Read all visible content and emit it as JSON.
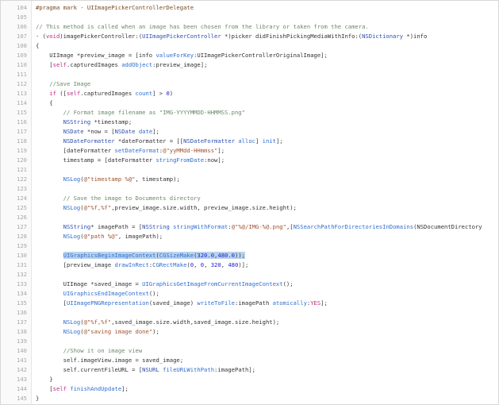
{
  "editor": {
    "lines": [
      {
        "n": "104",
        "tokens": [
          {
            "t": "#pragma mark - UIImagePickerControllerDelegate",
            "c": "pragma"
          }
        ]
      },
      {
        "n": "105",
        "tokens": []
      },
      {
        "n": "106",
        "tokens": [
          {
            "t": "// This method is called when an image has been chosen from the library or taken from the camera.",
            "c": "comment"
          }
        ]
      },
      {
        "n": "107",
        "tokens": [
          {
            "t": "- (",
            "c": "plain"
          },
          {
            "t": "void",
            "c": "kw"
          },
          {
            "t": ")imagePickerController:(",
            "c": "plain"
          },
          {
            "t": "UIImagePickerController",
            "c": "type"
          },
          {
            "t": " *)picker didFinishPickingMediaWithInfo:(",
            "c": "plain"
          },
          {
            "t": "NSDictionary",
            "c": "type"
          },
          {
            "t": " *)info",
            "c": "plain"
          }
        ]
      },
      {
        "n": "108",
        "tokens": [
          {
            "t": "{",
            "c": "plain"
          }
        ]
      },
      {
        "n": "109",
        "tokens": [
          {
            "t": "    UIImage *preview_image = [info ",
            "c": "plain"
          },
          {
            "t": "valueForKey",
            "c": "method"
          },
          {
            "t": ":UIImagePickerControllerOriginalImage];",
            "c": "plain"
          }
        ]
      },
      {
        "n": "110",
        "tokens": [
          {
            "t": "    [",
            "c": "plain"
          },
          {
            "t": "self",
            "c": "kw"
          },
          {
            "t": ".capturedImages ",
            "c": "plain"
          },
          {
            "t": "addObject",
            "c": "method"
          },
          {
            "t": ":preview_image];",
            "c": "plain"
          }
        ]
      },
      {
        "n": "111",
        "tokens": []
      },
      {
        "n": "112",
        "tokens": [
          {
            "t": "    //Save Image",
            "c": "comment"
          }
        ]
      },
      {
        "n": "113",
        "tokens": [
          {
            "t": "    ",
            "c": "plain"
          },
          {
            "t": "if",
            "c": "kw"
          },
          {
            "t": " ([",
            "c": "plain"
          },
          {
            "t": "self",
            "c": "kw"
          },
          {
            "t": ".capturedImages ",
            "c": "plain"
          },
          {
            "t": "count",
            "c": "method"
          },
          {
            "t": "] > ",
            "c": "plain"
          },
          {
            "t": "0",
            "c": "num"
          },
          {
            "t": ")",
            "c": "plain"
          }
        ]
      },
      {
        "n": "114",
        "tokens": [
          {
            "t": "    {",
            "c": "plain"
          }
        ]
      },
      {
        "n": "115",
        "tokens": [
          {
            "t": "        // Format image filename as \"IMG-YYYYMMDD-HHMMSS.png\"",
            "c": "comment"
          }
        ]
      },
      {
        "n": "116",
        "tokens": [
          {
            "t": "        ",
            "c": "plain"
          },
          {
            "t": "NSString",
            "c": "type"
          },
          {
            "t": " *timestamp;",
            "c": "plain"
          }
        ]
      },
      {
        "n": "117",
        "tokens": [
          {
            "t": "        ",
            "c": "plain"
          },
          {
            "t": "NSDate",
            "c": "type"
          },
          {
            "t": " *now = [",
            "c": "plain"
          },
          {
            "t": "NSDate",
            "c": "type"
          },
          {
            "t": " ",
            "c": "plain"
          },
          {
            "t": "date",
            "c": "method"
          },
          {
            "t": "];",
            "c": "plain"
          }
        ]
      },
      {
        "n": "118",
        "tokens": [
          {
            "t": "        ",
            "c": "plain"
          },
          {
            "t": "NSDateFormatter",
            "c": "type"
          },
          {
            "t": " *dateFormatter = [[",
            "c": "plain"
          },
          {
            "t": "NSDateFormatter",
            "c": "type"
          },
          {
            "t": " ",
            "c": "plain"
          },
          {
            "t": "alloc",
            "c": "method"
          },
          {
            "t": "] ",
            "c": "plain"
          },
          {
            "t": "init",
            "c": "method"
          },
          {
            "t": "];",
            "c": "plain"
          }
        ]
      },
      {
        "n": "119",
        "tokens": [
          {
            "t": "        [dateFormatter ",
            "c": "plain"
          },
          {
            "t": "setDateFormat",
            "c": "method"
          },
          {
            "t": ":",
            "c": "plain"
          },
          {
            "t": "@\"yyMMdd-HHmmss\"",
            "c": "str"
          },
          {
            "t": "];",
            "c": "plain"
          }
        ]
      },
      {
        "n": "120",
        "tokens": [
          {
            "t": "        timestamp = [dateFormatter ",
            "c": "plain"
          },
          {
            "t": "stringFromDate",
            "c": "method"
          },
          {
            "t": ":now];",
            "c": "plain"
          }
        ]
      },
      {
        "n": "121",
        "tokens": []
      },
      {
        "n": "122",
        "tokens": [
          {
            "t": "        ",
            "c": "plain"
          },
          {
            "t": "NSLog",
            "c": "method"
          },
          {
            "t": "(",
            "c": "plain"
          },
          {
            "t": "@\"timestamp %@\"",
            "c": "str"
          },
          {
            "t": ", timestamp);",
            "c": "plain"
          }
        ]
      },
      {
        "n": "123",
        "tokens": []
      },
      {
        "n": "124",
        "tokens": [
          {
            "t": "        // Save the image to Documents directory",
            "c": "comment"
          }
        ]
      },
      {
        "n": "125",
        "tokens": [
          {
            "t": "        ",
            "c": "plain"
          },
          {
            "t": "NSLog",
            "c": "method"
          },
          {
            "t": "(",
            "c": "plain"
          },
          {
            "t": "@\"%f,%f\"",
            "c": "str"
          },
          {
            "t": ",preview_image.size.width, preview_image.size.height);",
            "c": "plain"
          }
        ]
      },
      {
        "n": "126",
        "tokens": []
      },
      {
        "n": "127",
        "tokens": [
          {
            "t": "        ",
            "c": "plain"
          },
          {
            "t": "NSString",
            "c": "type"
          },
          {
            "t": "* imagePath = [",
            "c": "plain"
          },
          {
            "t": "NSString",
            "c": "type"
          },
          {
            "t": " ",
            "c": "plain"
          },
          {
            "t": "stringWithFormat",
            "c": "method"
          },
          {
            "t": ":",
            "c": "plain"
          },
          {
            "t": "@\"%@/IMG-%@.png\"",
            "c": "str"
          },
          {
            "t": ",[",
            "c": "plain"
          },
          {
            "t": "NSSearchPathForDirectoriesInDomains",
            "c": "method"
          },
          {
            "t": "(NSDocumentDirectory",
            "c": "plain"
          }
        ]
      },
      {
        "n": "128",
        "tokens": [
          {
            "t": "        ",
            "c": "plain"
          },
          {
            "t": "NSLog",
            "c": "method"
          },
          {
            "t": "(",
            "c": "plain"
          },
          {
            "t": "@\"path %@\"",
            "c": "str"
          },
          {
            "t": ", imagePath);",
            "c": "plain"
          }
        ]
      },
      {
        "n": "129",
        "tokens": []
      },
      {
        "n": "130",
        "hl": true,
        "tokens": [
          {
            "t": "        ",
            "c": "plain"
          },
          {
            "t": "UIGraphicsBeginImageContext",
            "c": "method"
          },
          {
            "t": "(",
            "c": "plain"
          },
          {
            "t": "CGSizeMake",
            "c": "method"
          },
          {
            "t": "(",
            "c": "plain"
          },
          {
            "t": "320.0",
            "c": "num"
          },
          {
            "t": ",",
            "c": "plain"
          },
          {
            "t": "480.0",
            "c": "num"
          },
          {
            "t": "));",
            "c": "plain"
          }
        ]
      },
      {
        "n": "131",
        "tokens": [
          {
            "t": "        [preview_image ",
            "c": "plain"
          },
          {
            "t": "drawInRect",
            "c": "method"
          },
          {
            "t": ":",
            "c": "plain"
          },
          {
            "t": "CGRectMake",
            "c": "method"
          },
          {
            "t": "(",
            "c": "plain"
          },
          {
            "t": "0",
            "c": "num"
          },
          {
            "t": ", ",
            "c": "plain"
          },
          {
            "t": "0",
            "c": "num"
          },
          {
            "t": ", ",
            "c": "plain"
          },
          {
            "t": "320",
            "c": "num"
          },
          {
            "t": ", ",
            "c": "plain"
          },
          {
            "t": "480",
            "c": "num"
          },
          {
            "t": ")];",
            "c": "plain"
          }
        ]
      },
      {
        "n": "132",
        "tokens": []
      },
      {
        "n": "133",
        "tokens": [
          {
            "t": "        UIImage *saved_image = ",
            "c": "plain"
          },
          {
            "t": "UIGraphicsGetImageFromCurrentImageContext",
            "c": "method"
          },
          {
            "t": "();",
            "c": "plain"
          }
        ]
      },
      {
        "n": "134",
        "tokens": [
          {
            "t": "        ",
            "c": "plain"
          },
          {
            "t": "UIGraphicsEndImageContext",
            "c": "method"
          },
          {
            "t": "();",
            "c": "plain"
          }
        ]
      },
      {
        "n": "135",
        "tokens": [
          {
            "t": "        [",
            "c": "plain"
          },
          {
            "t": "UIImagePNGRepresentation",
            "c": "method"
          },
          {
            "t": "(saved_image) ",
            "c": "plain"
          },
          {
            "t": "writeToFile",
            "c": "method"
          },
          {
            "t": ":imagePath ",
            "c": "plain"
          },
          {
            "t": "atomically",
            "c": "method"
          },
          {
            "t": ":",
            "c": "plain"
          },
          {
            "t": "YES",
            "c": "kw"
          },
          {
            "t": "];",
            "c": "plain"
          }
        ]
      },
      {
        "n": "136",
        "tokens": []
      },
      {
        "n": "137",
        "tokens": [
          {
            "t": "        ",
            "c": "plain"
          },
          {
            "t": "NSLog",
            "c": "method"
          },
          {
            "t": "(",
            "c": "plain"
          },
          {
            "t": "@\"%f,%f\"",
            "c": "str"
          },
          {
            "t": ",saved_image.size.width,saved_image.size.height);",
            "c": "plain"
          }
        ]
      },
      {
        "n": "138",
        "tokens": [
          {
            "t": "        ",
            "c": "plain"
          },
          {
            "t": "NSLog",
            "c": "method"
          },
          {
            "t": "(",
            "c": "plain"
          },
          {
            "t": "@\"saving image done\"",
            "c": "str"
          },
          {
            "t": ");",
            "c": "plain"
          }
        ]
      },
      {
        "n": "139",
        "tokens": []
      },
      {
        "n": "140",
        "tokens": [
          {
            "t": "        //Show it on image view",
            "c": "comment"
          }
        ]
      },
      {
        "n": "141",
        "tokens": [
          {
            "t": "        self.imageView.image = saved_image;",
            "c": "plain"
          }
        ]
      },
      {
        "n": "142",
        "tokens": [
          {
            "t": "        self.currentFileURL = [",
            "c": "plain"
          },
          {
            "t": "NSURL",
            "c": "type"
          },
          {
            "t": " ",
            "c": "plain"
          },
          {
            "t": "fileURLWithPath",
            "c": "method"
          },
          {
            "t": ":imagePath];",
            "c": "plain"
          }
        ]
      },
      {
        "n": "143",
        "tokens": [
          {
            "t": "    }",
            "c": "plain"
          }
        ]
      },
      {
        "n": "144",
        "tokens": [
          {
            "t": "    [",
            "c": "plain"
          },
          {
            "t": "self",
            "c": "kw"
          },
          {
            "t": " ",
            "c": "plain"
          },
          {
            "t": "finishAndUpdate",
            "c": "method"
          },
          {
            "t": "];",
            "c": "plain"
          }
        ]
      },
      {
        "n": "145",
        "tokens": [
          {
            "t": "}",
            "c": "plain"
          }
        ]
      }
    ]
  },
  "colors": {
    "plain": "#333333",
    "keyword": "#c02a86",
    "type": "#2f4fb0",
    "method": "#2f6fd0",
    "string": "#a0522d",
    "number": "#1b1bd6",
    "comment": "#6a8a6a",
    "line_number": "#a8a8a8",
    "selection": "#b9d3ee"
  }
}
